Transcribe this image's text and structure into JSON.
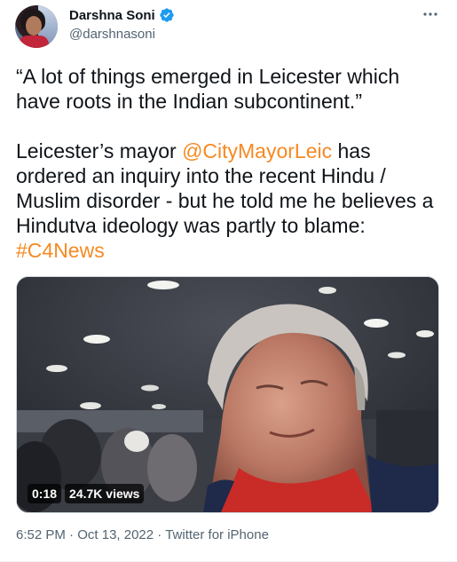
{
  "author": {
    "name": "Darshna Soni",
    "handle": "@darshnasoni",
    "verified": true
  },
  "tweet": {
    "quote": "“A lot of things emerged in Leicester which have roots in the Indian subcontinent.”",
    "body_before": "Leicester’s mayor ",
    "mention": "@CityMayorLeic",
    "body_after": " has ordered an inquiry into the recent Hindu / Muslim disorder - but he told me he believes a Hindutva ideology was partly to blame: ",
    "hashtag": "#C4News"
  },
  "media": {
    "duration": "0:18",
    "views": "24.7K views"
  },
  "meta": {
    "time": "6:52 PM",
    "separator": " · ",
    "date": "Oct 13, 2022",
    "app": "Twitter for iPhone"
  },
  "colors": {
    "link": "#f58a23",
    "verified": "#1d9bf0",
    "secondary_text": "#536471"
  }
}
